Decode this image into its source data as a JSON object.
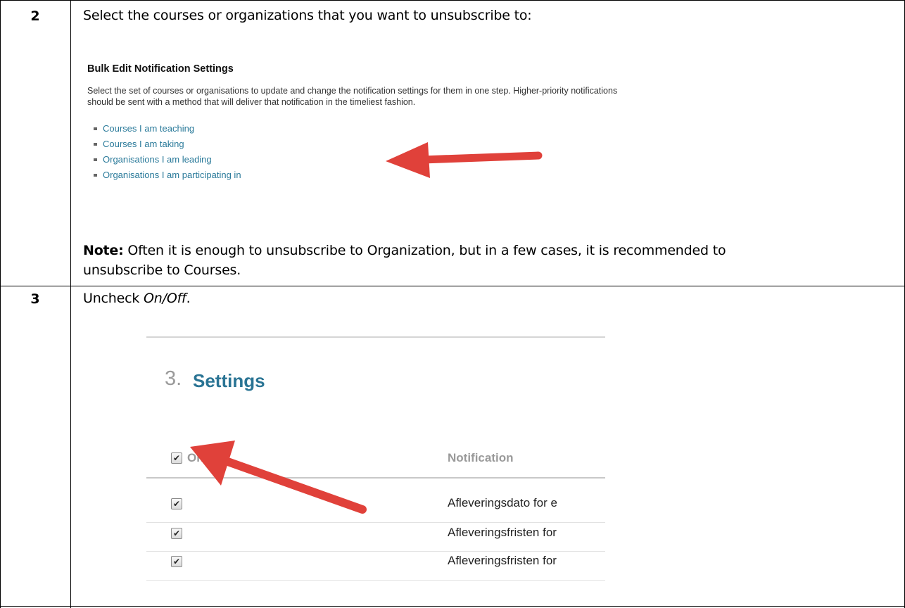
{
  "steps": [
    {
      "number": "2",
      "instruction": "Select the courses or organizations that you want to unsubscribe to:",
      "screenshot": {
        "title": "Bulk Edit Notification Settings",
        "description_line1": "Select the set of courses or organisations to update and change the notification settings for them in one step. Higher-priority notifications",
        "description_line2": "should be sent with a method that will deliver that notification in the timeliest fashion.",
        "links": [
          "Courses I am teaching",
          "Courses I am taking",
          "Organisations I am leading",
          "Organisations I am participating in"
        ]
      },
      "note_label": "Note:",
      "note_line1": " Often it is enough to unsubscribe to Organization, but in a few cases, it is recommended to",
      "note_line2": "unsubscribe to Courses."
    },
    {
      "number": "3",
      "instruction_prefix": "Uncheck ",
      "instruction_emphasis": "On/Off",
      "instruction_suffix": ".",
      "screenshot": {
        "section_number": "3.",
        "section_title": "Settings",
        "column_onoff": "On/Off",
        "column_notification": "Notification",
        "rows": [
          "Afleveringsdato for e",
          "Afleveringsfristen for",
          "Afleveringsfristen for"
        ],
        "checkmark": "✔"
      }
    }
  ],
  "colors": {
    "link": "#2a7a9a",
    "settings_title": "#2a7494",
    "arrow": "#e0413a"
  }
}
